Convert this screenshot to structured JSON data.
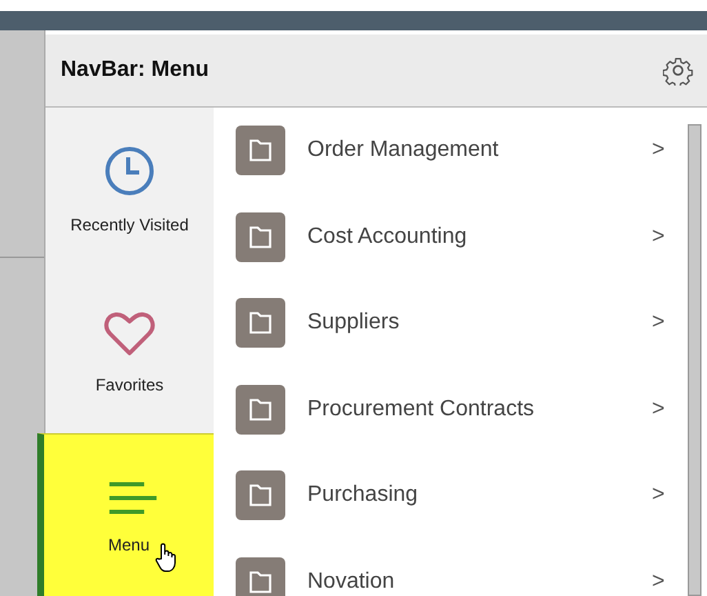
{
  "panel": {
    "title": "NavBar: Menu"
  },
  "nav_items": [
    {
      "label": "Recently Visited",
      "kind": "clock",
      "selected": false
    },
    {
      "label": "Favorites",
      "kind": "heart",
      "selected": false
    },
    {
      "label": "Menu",
      "kind": "menu",
      "selected": true
    }
  ],
  "menu_items": [
    {
      "label": "Order Management",
      "chevron": ">"
    },
    {
      "label": "Cost Accounting",
      "chevron": ">"
    },
    {
      "label": "Suppliers",
      "chevron": ">"
    },
    {
      "label": "Procurement Contracts",
      "chevron": ">"
    },
    {
      "label": "Purchasing",
      "chevron": ">"
    },
    {
      "label": "Novation",
      "chevron": ">"
    }
  ]
}
